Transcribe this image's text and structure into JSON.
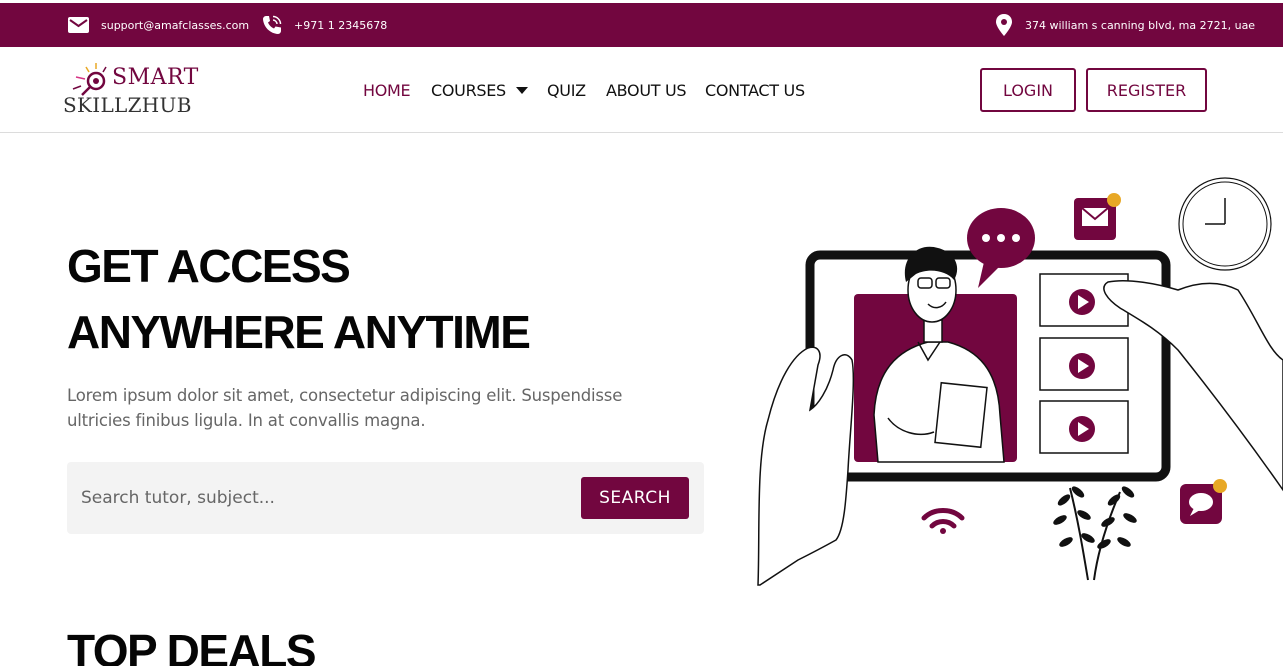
{
  "topbar": {
    "email": "support@amafclasses.com",
    "phone": "+971 1 2345678",
    "address": "374 william s canning blvd, ma 2721, uae",
    "icons": [
      "mail-icon",
      "phone-icon",
      "location-pin-icon"
    ]
  },
  "logo": {
    "line1": "SMART",
    "line2": "SKILLZHUB"
  },
  "nav": {
    "home": "HOME",
    "courses": "COURSES",
    "quiz": "QUIZ",
    "about": "ABOUT US",
    "contact": "CONTACT US"
  },
  "auth": {
    "login": "LOGIN",
    "register": "REGISTER"
  },
  "hero": {
    "title_line1": "GET ACCESS",
    "title_line2": "ANYWHERE ANYTIME",
    "description": "Lorem ipsum dolor sit amet, consectetur adipiscing elit. Suspendisse ultricies finibus ligula. In at convallis magna.",
    "search_placeholder": "Search tutor, subject...",
    "search_button": "SEARCH"
  },
  "deals": {
    "title": "TOP DEALS"
  },
  "colors": {
    "brand": "#72063f",
    "accent": "#e8a825"
  }
}
